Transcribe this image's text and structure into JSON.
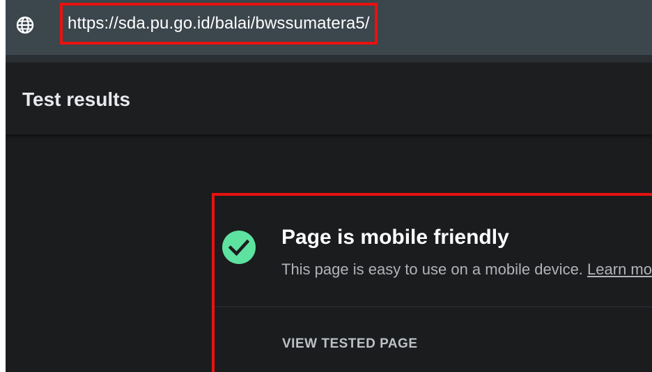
{
  "url_bar": {
    "url": "https://sda.pu.go.id/balai/bwssumatera5/",
    "icon": "globe-icon"
  },
  "header": {
    "title": "Test results"
  },
  "result_card": {
    "icon": "check-circle-icon",
    "heading": "Page is mobile friendly",
    "description": "This page is easy to use on a mobile device. ",
    "learn_more_label": "Learn more",
    "action_label": "VIEW TESTED PAGE"
  },
  "colors": {
    "highlight": "#e8120f",
    "success": "#5ee2a0",
    "background": "#1b1c1e",
    "url_bar": "#3b464d"
  }
}
